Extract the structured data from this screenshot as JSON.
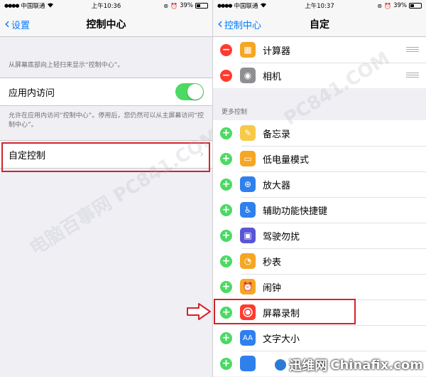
{
  "left": {
    "status": {
      "signal": "●●●●",
      "carrier": "中国联通",
      "time": "上午10:36",
      "battery": "39%"
    },
    "nav": {
      "back_label": "设置",
      "title": "控制中心"
    },
    "top_note": "从屏幕底部向上轻扫来显示“控制中心”。",
    "access_row": {
      "label": "应用内访问",
      "toggle_on": true
    },
    "access_note": "允许在应用内访问“控制中心”。停用后，您仍然可以从主屏幕访问“控制中心”。",
    "customize_row": {
      "label": "自定控制"
    }
  },
  "right": {
    "status": {
      "signal": "●●●●",
      "carrier": "中国联通",
      "time": "上午10:37",
      "battery": "39%"
    },
    "nav": {
      "back_label": "控制中心",
      "title": "自定"
    },
    "included": [
      {
        "label": "计算器",
        "icon": "calculator-icon",
        "color": "#f5a623"
      },
      {
        "label": "相机",
        "icon": "camera-icon",
        "color": "#8e8e93"
      }
    ],
    "more_header": "更多控制",
    "more": [
      {
        "label": "备忘录",
        "icon": "notes-icon",
        "color": "#f7c948"
      },
      {
        "label": "低电量模式",
        "icon": "battery-icon",
        "color": "#f5a623"
      },
      {
        "label": "放大器",
        "icon": "magnifier-icon",
        "color": "#2f80ed"
      },
      {
        "label": "辅助功能快捷键",
        "icon": "accessibility-icon",
        "color": "#2f80ed"
      },
      {
        "label": "驾驶勿扰",
        "icon": "car-icon",
        "color": "#5856d6"
      },
      {
        "label": "秒表",
        "icon": "stopwatch-icon",
        "color": "#f5a623"
      },
      {
        "label": "闹钟",
        "icon": "alarm-icon",
        "color": "#f5a623"
      },
      {
        "label": "屏幕录制",
        "icon": "screen-record-icon",
        "color": "#ff3b30"
      },
      {
        "label": "文字大小",
        "icon": "text-size-icon",
        "color": "#2f80ed"
      }
    ]
  },
  "watermark": {
    "left_text": "电脑百事网 PC841.COM",
    "right_text": "PC841.COM"
  },
  "brand": {
    "name": "迅维网",
    "domain": "Chinafix.com"
  }
}
